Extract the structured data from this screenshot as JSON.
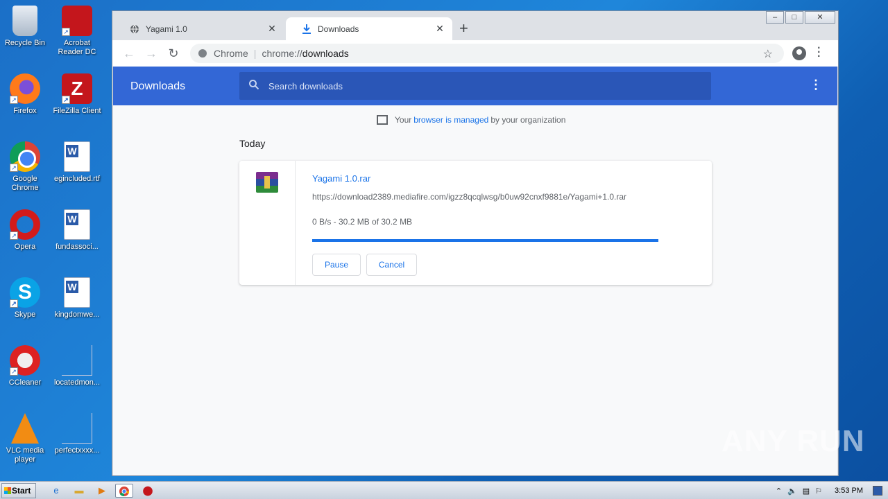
{
  "desktop": {
    "icons": [
      {
        "label": "Recycle Bin"
      },
      {
        "label": "Acrobat Reader DC"
      },
      {
        "label": "Firefox"
      },
      {
        "label": "FileZilla Client"
      },
      {
        "label": "Google Chrome"
      },
      {
        "label": "egincluded.rtf"
      },
      {
        "label": "Opera"
      },
      {
        "label": "fundassoci..."
      },
      {
        "label": "Skype"
      },
      {
        "label": "kingdomwe..."
      },
      {
        "label": "CCleaner"
      },
      {
        "label": "locatedmon..."
      },
      {
        "label": "VLC media player"
      },
      {
        "label": "perfectxxxx..."
      }
    ]
  },
  "browser": {
    "tabs": [
      {
        "title": "Yagami 1.0",
        "close": "✕"
      },
      {
        "title": "Downloads",
        "close": "✕"
      }
    ],
    "new_tab": "+",
    "omnibox": {
      "chip": "Chrome",
      "separator": "|",
      "scheme": "chrome://",
      "host": "downloads"
    },
    "window_controls": {
      "minimize": "–",
      "maximize": "□",
      "close": "✕"
    }
  },
  "downloads": {
    "title": "Downloads",
    "search_placeholder": "Search downloads",
    "managed": {
      "prefix": "Your ",
      "link": "browser is managed",
      "suffix": " by your organization"
    },
    "section": "Today",
    "item": {
      "file_name": "Yagami 1.0.rar",
      "url": "https://download2389.mediafire.com/igzz8qcqlwsg/b0uw92cnxf9881e/Yagami+1.0.rar",
      "status": "0 B/s - 30.2 MB of 30.2 MB",
      "progress": 1.0,
      "pause_label": "Pause",
      "cancel_label": "Cancel"
    }
  },
  "taskbar": {
    "start_label": "Start",
    "clock": "3:53 PM"
  },
  "watermark": "ANY RUN",
  "colors": {
    "header": "#3367d6",
    "accent": "#1a73e8"
  }
}
